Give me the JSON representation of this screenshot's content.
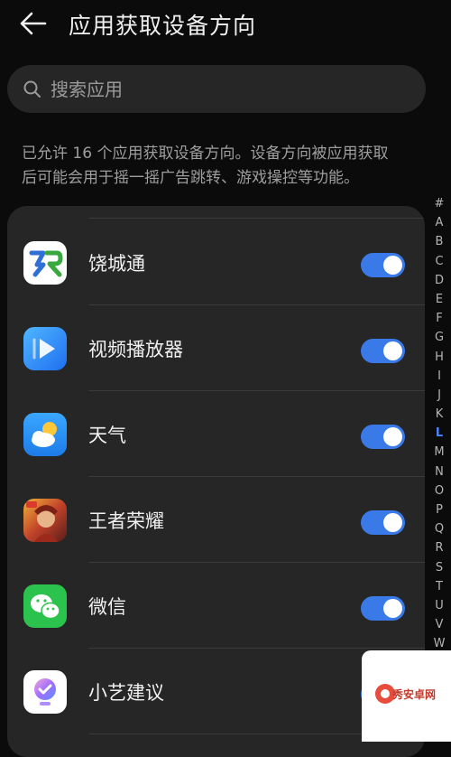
{
  "header": {
    "title": "应用获取设备方向",
    "back_icon": "arrow-left-icon"
  },
  "search": {
    "placeholder": "搜索应用",
    "value": "",
    "icon": "search-icon"
  },
  "description": {
    "line1": "已允许 16 个应用获取设备方向。设备方向被应用获取",
    "line2": "后可能会用于摇一摇广告跳转、游戏操控等功能。"
  },
  "apps": [
    {
      "name": "饶城通",
      "icon": "raochengtong-app-icon",
      "enabled": true
    },
    {
      "name": "视频播放器",
      "icon": "video-player-app-icon",
      "enabled": true
    },
    {
      "name": "天气",
      "icon": "weather-app-icon",
      "enabled": true
    },
    {
      "name": "王者荣耀",
      "icon": "honor-of-kings-app-icon",
      "enabled": true
    },
    {
      "name": "微信",
      "icon": "wechat-app-icon",
      "enabled": true
    },
    {
      "name": "小艺建议",
      "icon": "xiaoyi-suggestion-app-icon",
      "enabled": true
    }
  ],
  "index_letters": [
    "#",
    "A",
    "B",
    "C",
    "D",
    "E",
    "F",
    "G",
    "H",
    "I",
    "J",
    "K",
    "L",
    "M",
    "N",
    "O",
    "P",
    "Q",
    "R",
    "S",
    "T",
    "U",
    "V",
    "W"
  ],
  "index_active": "L",
  "watermark": {
    "text": "秀安卓网"
  },
  "colors": {
    "toggle_on": "#3a7ae8",
    "index_active": "#4a86ff",
    "card": "#262626",
    "background": "#0b0b0b"
  }
}
